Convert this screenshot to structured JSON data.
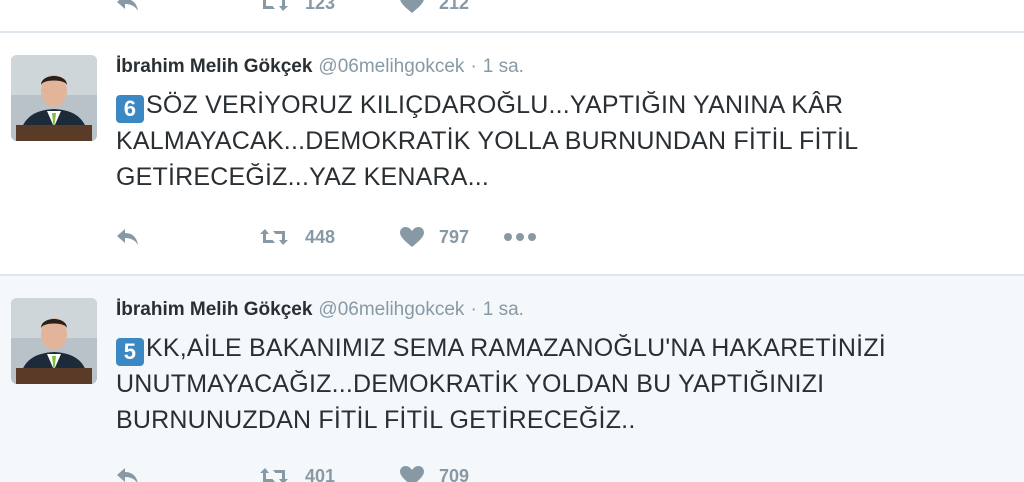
{
  "tweets": [
    {
      "id": "partial",
      "retweets": "123",
      "likes": "212"
    },
    {
      "id": "tweet-6",
      "name": "İbrahim Melih Gökçek",
      "handle": "@06melihgokcek",
      "separator": "·",
      "time": "1 sa.",
      "number": "6",
      "text": "SÖZ VERİYORUZ KILIÇDAROĞLU...YAPTIĞIN YANINA KÂR KALMAYACAK...DEMOKRATİK YOLLA BURNUNDAN FİTİL FİTİL GETİRECEĞİZ...YAZ KENARA...",
      "retweets": "448",
      "likes": "797"
    },
    {
      "id": "tweet-5",
      "name": "İbrahim Melih Gökçek",
      "handle": "@06melihgokcek",
      "separator": "·",
      "time": "1 sa.",
      "number": "5",
      "text": "KK,AİLE BAKANIMIZ SEMA RAMAZANOĞLU'NA HAKARETİNİZİ UNUTMAYACAĞIZ...DEMOKRATİK YOLDAN BU YAPTIĞINIZI BURNUNUZDAN FİTİL FİTİL GETİRECEĞİZ..",
      "retweets": "401",
      "likes": "709"
    }
  ],
  "icons": {
    "reply": "reply-icon",
    "retweet": "retweet-icon",
    "like": "heart-icon",
    "more": "more-icon",
    "keycap": "keycap-number-emoji"
  },
  "colors": {
    "text": "#292f33",
    "muted": "#8899a6",
    "keycap": "#3b88c3",
    "highlight": "#f5f8fa",
    "divider": "#e1e8ed"
  }
}
